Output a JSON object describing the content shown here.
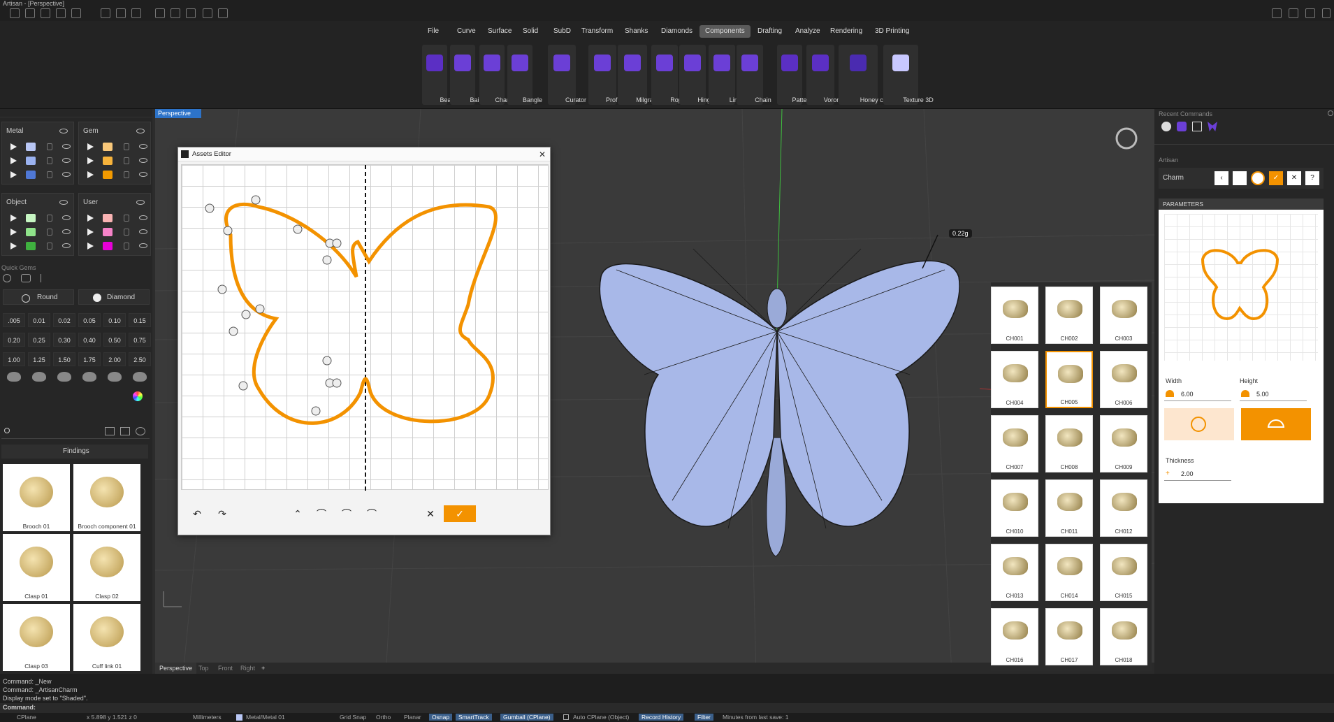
{
  "window": {
    "title": "Artisan - [Perspective]"
  },
  "menu": [
    "File",
    "Curve",
    "Surface",
    "Solid",
    "SubD",
    "Transform",
    "Shanks",
    "Diamonds",
    "Components",
    "Drafting",
    "Analyze",
    "Rendering",
    "3D Printing"
  ],
  "menu_active": "Components",
  "tools": [
    {
      "label": "Bead",
      "icon": "bead-icon"
    },
    {
      "label": "Bail",
      "icon": "bail-icon"
    },
    {
      "label": "Charm",
      "icon": "butterfly-icon"
    },
    {
      "label": "Bangle",
      "icon": "bangle-icon"
    },
    {
      "label": "Curator",
      "icon": "curator-icon"
    },
    {
      "label": "Profiles",
      "icon": "profiles-icon"
    },
    {
      "label": "Milgrain",
      "icon": "milgrain-icon"
    },
    {
      "label": "Rope",
      "icon": "rope-icon"
    },
    {
      "label": "Hinge",
      "icon": "hinge-icon"
    },
    {
      "label": "Link",
      "icon": "link-icon"
    },
    {
      "label": "Chain",
      "icon": "chain-icon"
    },
    {
      "label": "Pattern",
      "icon": "pattern-icon"
    },
    {
      "label": "Voronoi",
      "icon": "voronoi-icon"
    },
    {
      "label": "Honey comb",
      "icon": "honeycomb-icon"
    },
    {
      "label": "Texture 3D",
      "icon": "texture-icon"
    }
  ],
  "layers": {
    "metal": "Metal",
    "gem": "Gem",
    "object": "Object",
    "user": "User",
    "metal_colors": [
      "#b9c7f5",
      "#9ab2f0",
      "#4f78d6"
    ],
    "gem_colors": [
      "#f9c87a",
      "#f7b33b",
      "#f39a00"
    ],
    "object_colors": [
      "#c6f5c2",
      "#8fe38a",
      "#3fb13f"
    ],
    "user_colors": [
      "#f9b3b3",
      "#f583c8",
      "#e600d8"
    ]
  },
  "quick_gems": {
    "title": "Quick Gems",
    "shape": "Round",
    "type": "Diamond",
    "sizes": [
      ".005",
      "0.01",
      "0.02",
      "0.05",
      "0.10",
      "0.15",
      "0.20",
      "0.25",
      "0.30",
      "0.40",
      "0.50",
      "0.75",
      "1.00",
      "1.25",
      "1.50",
      "1.75",
      "2.00",
      "2.50"
    ]
  },
  "findings": {
    "title": "Findings",
    "items": [
      "Brooch 01",
      "Brooch component 01",
      "Clasp 01",
      "Clasp 02",
      "Clasp 03",
      "Cuff link 01"
    ]
  },
  "viewport": {
    "label": "Perspective",
    "tabs": [
      "Perspective",
      "Top",
      "Front",
      "Right"
    ],
    "weight": "0.22g"
  },
  "assets_editor": {
    "title": "Assets Editor"
  },
  "gallery": [
    "CH001",
    "CH002",
    "CH003",
    "CH004",
    "CH005",
    "CH006",
    "CH007",
    "CH008",
    "CH009",
    "CH010",
    "CH011",
    "CH012",
    "CH013",
    "CH014",
    "CH015",
    "CH016",
    "CH017",
    "CH018"
  ],
  "gallery_selected": "CH005",
  "right": {
    "recent": "Recent Commands",
    "artisan": "Artisan",
    "charm": "Charm",
    "parameters": "PARAMETERS",
    "width_label": "Width",
    "width": "6.00",
    "height_label": "Height",
    "height": "5.00",
    "thickness_label": "Thickness",
    "thickness": "2.00"
  },
  "commands": [
    "Command: _New",
    "Command: _ArtisanCharm",
    "Display mode set to \"Shaded\".",
    "Command:"
  ],
  "status": {
    "cplane": "CPlane",
    "coords": "x 5.898  y 1.521  z 0",
    "units": "Millimeters",
    "layer": "Metal/Metal 01",
    "items": [
      "Grid Snap",
      "Ortho",
      "Planar",
      "Osnap",
      "SmartTrack",
      "Gumball (CPlane)",
      "Auto CPlane (Object)",
      "Record History",
      "Filter",
      "Minutes from last save: 1"
    ]
  },
  "colors": {
    "accent": "#f39200",
    "model": "#a8b8e8",
    "panel": "#262626"
  }
}
